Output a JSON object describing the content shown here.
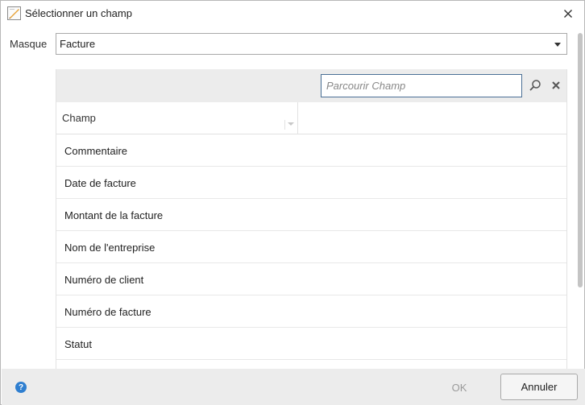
{
  "window": {
    "title": "Sélectionner un champ",
    "app_icon": "dialog-app-icon",
    "close_icon": "close-icon"
  },
  "masque": {
    "label": "Masque",
    "selected": "Facture"
  },
  "search": {
    "placeholder": "Parcourir Champ",
    "value": ""
  },
  "table": {
    "column_header": "Champ",
    "rows": [
      "Commentaire",
      "Date de facture",
      "Montant de la facture",
      "Nom de l'entreprise",
      "Numéro de client",
      "Numéro de facture",
      "Statut"
    ]
  },
  "footer": {
    "help_label": "?",
    "ok_label": "OK",
    "cancel_label": "Annuler"
  },
  "colors": {
    "accent": "#2f7fd0",
    "search_border": "#4a6f95",
    "toolbar_bg": "#ececec"
  }
}
